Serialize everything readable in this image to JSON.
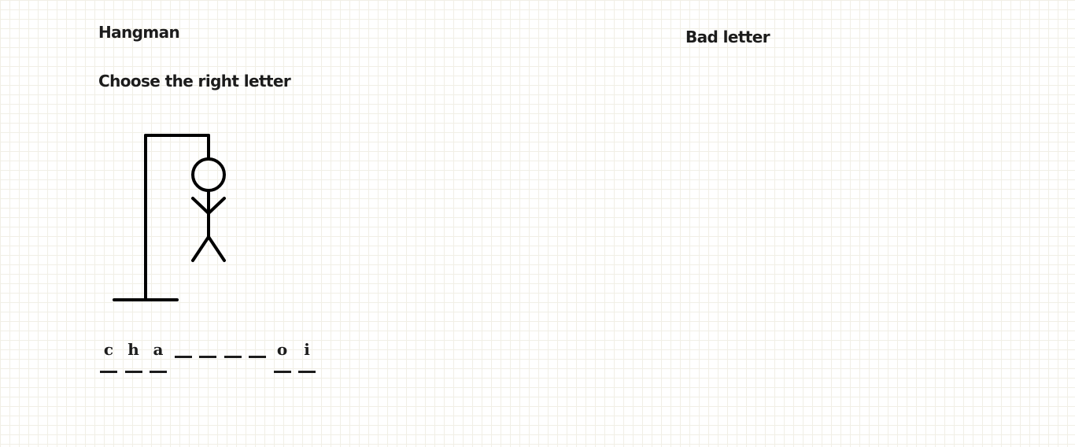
{
  "game": {
    "title": "Hangman",
    "instruction": "Choose the right letter"
  },
  "bad_letters": {
    "title": "Bad letter",
    "letters": []
  },
  "hangman": {
    "parts_shown": [
      "head",
      "body",
      "left-arm",
      "right-arm",
      "left-leg",
      "right-leg"
    ]
  },
  "word": {
    "slots": [
      {
        "letter": "c",
        "revealed": true
      },
      {
        "letter": "h",
        "revealed": true
      },
      {
        "letter": "a",
        "revealed": true
      },
      {
        "letter": "",
        "revealed": false
      },
      {
        "letter": "",
        "revealed": false
      },
      {
        "letter": "",
        "revealed": false
      },
      {
        "letter": "",
        "revealed": false
      },
      {
        "letter": "o",
        "revealed": true
      },
      {
        "letter": "i",
        "revealed": true
      }
    ]
  },
  "colors": {
    "ink": "#1c1c1c",
    "grid": "#f1efe6",
    "background": "#ffffff"
  }
}
